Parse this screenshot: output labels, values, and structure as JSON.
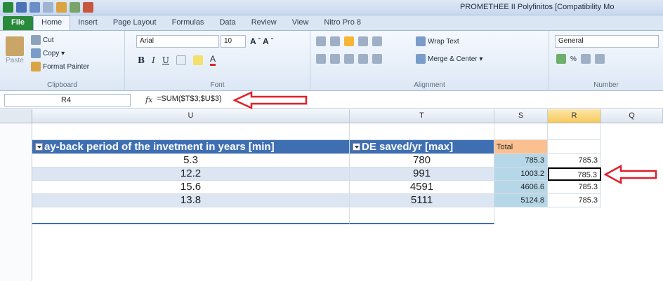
{
  "window": {
    "title": "PROMETHEE II Polyfinitos  [Compatibility Mo"
  },
  "tabs": [
    "File",
    "Home",
    "Insert",
    "Page Layout",
    "Formulas",
    "Data",
    "Review",
    "View",
    "Nitro Pro 8"
  ],
  "ribbon": {
    "clipboard": {
      "paste": "Paste",
      "cut": "Cut",
      "copy": "Copy ▾",
      "format_painter": "Format Painter",
      "label": "Clipboard"
    },
    "font": {
      "name": "Arial",
      "size": "10",
      "label": "Font"
    },
    "alignment": {
      "wrap_text": "Wrap Text",
      "merge_center": "Merge & Center ▾",
      "label": "Alignment"
    },
    "number": {
      "format": "General",
      "label": "Number",
      "percent": "%"
    }
  },
  "formula_bar": {
    "name_box": "R4",
    "fx": "fx",
    "formula": "=SUM($T$3;$U$3)"
  },
  "columns": [
    "U",
    "T",
    "S",
    "R",
    "Q"
  ],
  "table": {
    "headers": [
      "ay-back period of the invetment in years [min]",
      "DE saved/yr [max]"
    ],
    "rows": [
      {
        "u": "5.3",
        "t": "780",
        "s": "785.3",
        "r": "785.3"
      },
      {
        "u": "12.2",
        "t": "991",
        "s": "1003.2",
        "r": "785.3"
      },
      {
        "u": "15.6",
        "t": "4591",
        "s": "4606.6",
        "r": "785.3"
      },
      {
        "u": "13.8",
        "t": "5111",
        "s": "5124.8",
        "r": "785.3"
      }
    ],
    "total_label": "Total"
  },
  "colors": {
    "file_tab": "#2a8a3c",
    "table_header": "#3e6fb3",
    "band": "#dce6f2",
    "total": "#fac090",
    "arrow": "#e0202a"
  }
}
